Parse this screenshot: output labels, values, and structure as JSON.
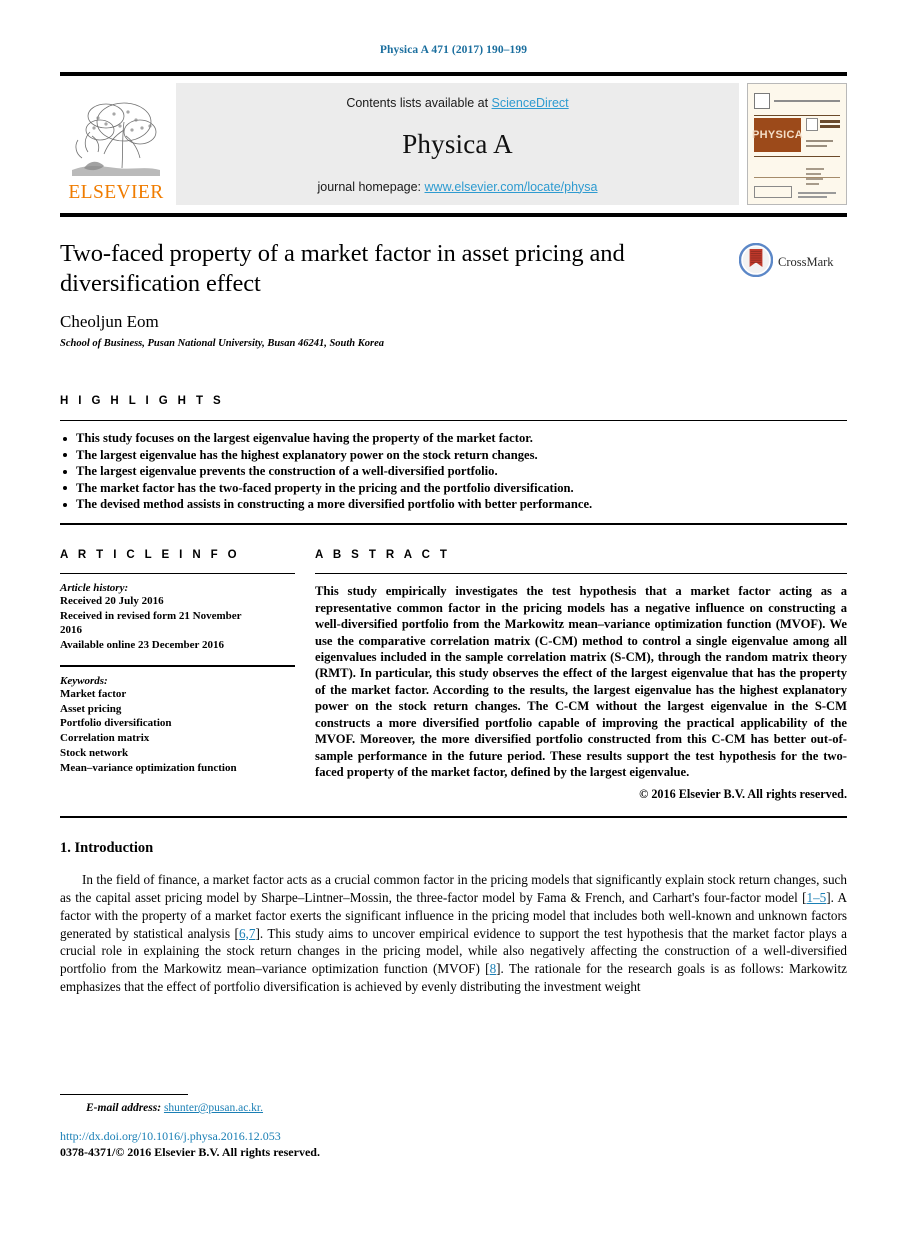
{
  "running_head": "Physica A 471 (2017) 190–199",
  "journal_header": {
    "contents_prefix": "Contents lists available at ",
    "contents_link": "ScienceDirect",
    "journal_name": "Physica A",
    "homepage_prefix": "journal homepage: ",
    "homepage_link": "www.elsevier.com/locate/physa",
    "publisher": "ELSEVIER",
    "cover_band_text": "PHYSICA"
  },
  "article": {
    "title": "Two-faced property of a market factor in asset pricing and diversification effect",
    "author": "Cheoljun Eom",
    "affiliation": "School of Business, Pusan National University, Busan 46241, South Korea",
    "crossmark_label": "CrossMark"
  },
  "highlights": {
    "heading": "H I G H L I G H T S",
    "items": [
      "This study focuses on the largest eigenvalue having the property of the market factor.",
      "The largest eigenvalue has the highest explanatory power on the stock return changes.",
      "The largest eigenvalue prevents the construction of a well-diversified portfolio.",
      "The market factor has the two-faced property in the pricing and the portfolio diversification.",
      "The devised method assists in constructing a more diversified portfolio with better performance."
    ]
  },
  "article_info": {
    "heading": "A R T I C L E   I N F O",
    "history_label": "Article history:",
    "history": [
      "Received 20 July 2016",
      "Received in revised form 21 November",
      "2016",
      "Available online 23 December 2016"
    ],
    "keywords_label": "Keywords:",
    "keywords": [
      "Market factor",
      "Asset pricing",
      "Portfolio diversification",
      "Correlation matrix",
      "Stock network",
      "Mean–variance optimization function"
    ]
  },
  "abstract": {
    "heading": "A B S T R A C T",
    "body": "This study empirically investigates the test hypothesis that a market factor acting as a representative common factor in the pricing models has a negative influence on constructing a well-diversified portfolio from the Markowitz mean–variance optimization function (MVOF). We use the comparative correlation matrix (C-CM) method to control a single eigenvalue among all eigenvalues included in the sample correlation matrix (S-CM), through the random matrix theory (RMT). In particular, this study observes the effect of the largest eigenvalue that has the property of the market factor. According to the results, the largest eigenvalue has the highest explanatory power on the stock return changes. The C-CM without the largest eigenvalue in the S-CM constructs a more diversified portfolio capable of improving the practical applicability of the MVOF. Moreover, the more diversified portfolio constructed from this C-CM has better out-of-sample performance in the future period. These results support the test hypothesis for the two-faced property of the market factor, defined by the largest eigenvalue.",
    "copyright": "© 2016 Elsevier B.V. All rights reserved."
  },
  "introduction": {
    "heading": "1. Introduction",
    "paragraph_part1": "In the field of finance, a market factor acts as a crucial common factor in the pricing models that significantly explain stock return changes, such as the capital asset pricing model by Sharpe–Lintner–Mossin, the three-factor model by Fama & French, and Carhart's four-factor model [",
    "citation1": "1–5",
    "paragraph_part2": "]. A factor with the property of a market factor exerts the significant influence in the pricing model that includes both well-known and unknown factors generated by statistical analysis [",
    "citation2": "6,7",
    "paragraph_part3": "]. This study aims to uncover empirical evidence to support the test hypothesis that the market factor plays a crucial role in explaining the stock return changes in the pricing model, while also negatively affecting the construction of a well-diversified portfolio from the Markowitz mean–variance optimization function (MVOF) [",
    "citation3": "8",
    "paragraph_part4": "]. The rationale for the research goals is as follows: Markowitz emphasizes that the effect of portfolio diversification is achieved by evenly distributing the investment weight"
  },
  "footer": {
    "email_label": "E-mail address:",
    "email": "shunter@pusan.ac.kr.",
    "doi": "http://dx.doi.org/10.1016/j.physa.2016.12.053",
    "issn_copyright": "0378-4371/© 2016 Elsevier B.V. All rights reserved."
  },
  "colors": {
    "link_blue": "#1a7fb5",
    "sciencedirect_blue": "#2e9bd0",
    "elsevier_orange": "#f07c00",
    "cover_band": "#9c4a1a"
  }
}
